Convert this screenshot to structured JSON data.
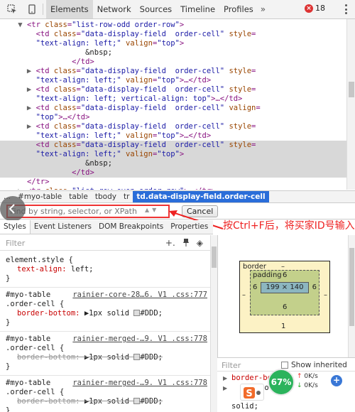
{
  "toolbar": {
    "tabs": [
      "Elements",
      "Network",
      "Sources",
      "Timeline",
      "Profiles"
    ],
    "more": "»",
    "error_count": "18"
  },
  "tree": {
    "lines": [
      {
        "indent": "      ",
        "tri": "▼",
        "parts": [
          [
            "t",
            "<tr "
          ],
          [
            "a",
            "class"
          ],
          [
            "t",
            "="
          ],
          [
            "v",
            "\"list-row-odd order-row\""
          ],
          [
            "t",
            ">"
          ]
        ]
      },
      {
        "indent": "        ",
        "tri": "",
        "parts": [
          [
            "t",
            "<td "
          ],
          [
            "a",
            "class"
          ],
          [
            "t",
            "="
          ],
          [
            "v",
            "\"data-display-field  order-cell\""
          ],
          [
            "t",
            " "
          ],
          [
            "a",
            "style"
          ],
          [
            "t",
            "="
          ]
        ]
      },
      {
        "indent": "        ",
        "tri": "",
        "parts": [
          [
            "v",
            "\"text-align: left;\""
          ],
          [
            "t",
            " "
          ],
          [
            "a",
            "valign"
          ],
          [
            "t",
            "="
          ],
          [
            "v",
            "\"top\""
          ],
          [
            "t",
            ">"
          ]
        ]
      },
      {
        "indent": "                   ",
        "tri": "",
        "parts": [
          [
            "tx",
            "&nbsp;"
          ]
        ]
      },
      {
        "indent": "                ",
        "tri": "",
        "parts": [
          [
            "t",
            "</td>"
          ]
        ]
      },
      {
        "indent": "        ",
        "tri": "▶",
        "parts": [
          [
            "t",
            "<td "
          ],
          [
            "a",
            "class"
          ],
          [
            "t",
            "="
          ],
          [
            "v",
            "\"data-display-field  order-cell\""
          ],
          [
            "t",
            " "
          ],
          [
            "a",
            "style"
          ],
          [
            "t",
            "="
          ]
        ]
      },
      {
        "indent": "        ",
        "tri": "",
        "parts": [
          [
            "v",
            "\"text-align: left;\""
          ],
          [
            "t",
            " "
          ],
          [
            "a",
            "valign"
          ],
          [
            "t",
            "="
          ],
          [
            "v",
            "\"top\""
          ],
          [
            "t",
            ">…</td>"
          ]
        ]
      },
      {
        "indent": "        ",
        "tri": "▶",
        "parts": [
          [
            "t",
            "<td "
          ],
          [
            "a",
            "class"
          ],
          [
            "t",
            "="
          ],
          [
            "v",
            "\"data-display-field  order-cell\""
          ],
          [
            "t",
            " "
          ],
          [
            "a",
            "style"
          ],
          [
            "t",
            "="
          ]
        ]
      },
      {
        "indent": "        ",
        "tri": "",
        "parts": [
          [
            "v",
            "\"text-align: left; vertical-align: top\""
          ],
          [
            "t",
            ">…</td>"
          ]
        ]
      },
      {
        "indent": "        ",
        "tri": "▶",
        "parts": [
          [
            "t",
            "<td "
          ],
          [
            "a",
            "class"
          ],
          [
            "t",
            "="
          ],
          [
            "v",
            "\"data-display-field  order-cell\""
          ],
          [
            "t",
            " "
          ],
          [
            "a",
            "valign"
          ],
          [
            "t",
            "="
          ]
        ]
      },
      {
        "indent": "        ",
        "tri": "",
        "parts": [
          [
            "v",
            "\"top\""
          ],
          [
            "t",
            ">…</td>"
          ]
        ]
      },
      {
        "indent": "        ",
        "tri": "▶",
        "parts": [
          [
            "t",
            "<td "
          ],
          [
            "a",
            "class"
          ],
          [
            "t",
            "="
          ],
          [
            "v",
            "\"data-display-field  order-cell\""
          ],
          [
            "t",
            " "
          ],
          [
            "a",
            "style"
          ],
          [
            "t",
            "="
          ]
        ]
      },
      {
        "indent": "        ",
        "tri": "",
        "parts": [
          [
            "v",
            "\"text-align: left;\""
          ],
          [
            "t",
            " "
          ],
          [
            "a",
            "valign"
          ],
          [
            "t",
            "="
          ],
          [
            "v",
            "\"top\""
          ],
          [
            "t",
            ">…</td>"
          ]
        ]
      },
      {
        "indent": "        ",
        "tri": "",
        "sel": true,
        "parts": [
          [
            "t",
            "<td "
          ],
          [
            "a",
            "class"
          ],
          [
            "t",
            "="
          ],
          [
            "v",
            "\"data-display-field  order-cell\""
          ],
          [
            "t",
            " "
          ],
          [
            "a",
            "style"
          ],
          [
            "t",
            "="
          ]
        ]
      },
      {
        "indent": "        ",
        "tri": "",
        "sel": true,
        "parts": [
          [
            "v",
            "\"text-align: left;\""
          ],
          [
            "t",
            " "
          ],
          [
            "a",
            "valign"
          ],
          [
            "t",
            "="
          ],
          [
            "v",
            "\"top\""
          ],
          [
            "t",
            ">"
          ]
        ]
      },
      {
        "indent": "                   ",
        "tri": "",
        "sel": true,
        "parts": [
          [
            "tx",
            "&nbsp;"
          ]
        ]
      },
      {
        "indent": "                ",
        "tri": "",
        "sel": true,
        "parts": [
          [
            "t",
            "</td>"
          ]
        ]
      },
      {
        "indent": "      ",
        "tri": "",
        "parts": [
          [
            "t",
            "</tr>"
          ]
        ]
      },
      {
        "indent": "      ",
        "tri": "▶",
        "parts": [
          [
            "t",
            "<tr "
          ],
          [
            "a",
            "class"
          ],
          [
            "t",
            "="
          ],
          [
            "v",
            "\"list-row-even order-row\""
          ],
          [
            "t",
            ">…</tr>"
          ]
        ]
      }
    ]
  },
  "breadcrumb": [
    "...",
    "#myo-table",
    "table",
    "tbody",
    "tr",
    "td.data-display-field.order-cell"
  ],
  "find": {
    "placeholder": "Find by string, selector, or XPath",
    "cancel_label": "Cancel"
  },
  "annotation": "按Ctrl+F后，将买家ID号输入",
  "styles": {
    "tabs": [
      "Styles",
      "Event Listeners",
      "DOM Breakpoints",
      "Properties"
    ],
    "filter_placeholder": "Filter",
    "rules": [
      {
        "lines": [
          [
            "sel",
            "element.style {"
          ],
          [
            "decl",
            "text-align: left;"
          ],
          [
            "sel",
            "}"
          ]
        ]
      },
      {
        "source": "rainier-core-28…6. V1 .css:777",
        "lines": [
          [
            "sel",
            "#myo-table"
          ],
          [
            "sel",
            ".order-cell {"
          ],
          [
            "decl",
            "border-bottom: ▶1px solid  #DDD;"
          ],
          [
            "sel",
            "}"
          ]
        ]
      },
      {
        "source": "rainier-merged-…9. V1 .css:778",
        "lines": [
          [
            "sel",
            "#myo-table"
          ],
          [
            "sel",
            ".order-cell {"
          ],
          [
            "strike",
            "border-bottom: ▶1px solid  #DDD;"
          ],
          [
            "sel",
            "}"
          ]
        ]
      },
      {
        "source": "rainier-merged-…9. V1 .css:778",
        "lines": [
          [
            "sel",
            "#myo-table"
          ],
          [
            "sel",
            ".order-cell {"
          ],
          [
            "strike",
            "border-bottom: ▶1px solid  #DDD;"
          ],
          [
            "sel",
            "}"
          ]
        ]
      }
    ]
  },
  "box_model": {
    "border_label": "border",
    "border_value": "–",
    "padding_label": "padding",
    "padding_top": "6",
    "padding_left": "6",
    "padding_right": "6",
    "padding_bottom": "6",
    "content_size": "199 × 140",
    "border_bottom": "1",
    "border_left": "–",
    "border_right": "–"
  },
  "computed": {
    "filter_placeholder": "Filter",
    "show_inherited": "Show inherited",
    "lines": [
      "border-bo",
      "sol",
      "solid;"
    ]
  },
  "overlay": {
    "speed": "67%",
    "up": "0K/s",
    "down": "0K/s",
    "plus": "+"
  }
}
